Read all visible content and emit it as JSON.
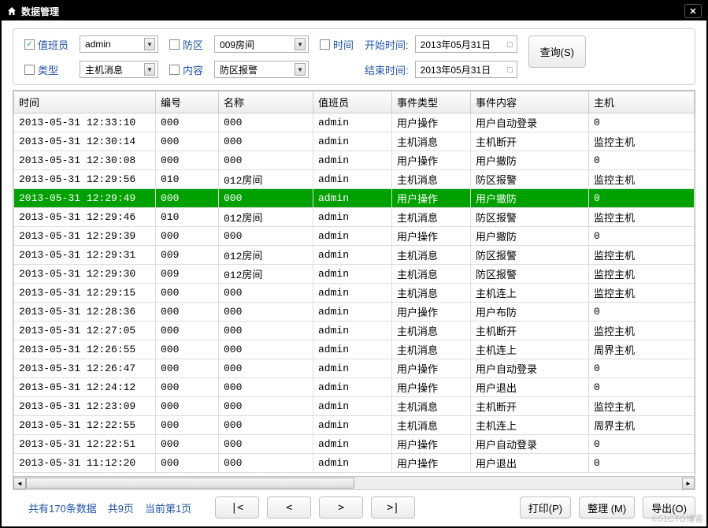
{
  "window": {
    "title": "数据管理"
  },
  "filters": {
    "operator": {
      "label": "值班员",
      "value": "admin",
      "checked": true
    },
    "type": {
      "label": "类型",
      "value": "主机消息",
      "checked": false
    },
    "zone": {
      "label": "防区",
      "value": "009房间",
      "checked": false
    },
    "content": {
      "label": "内容",
      "value": "防区报警",
      "checked": false
    },
    "time": {
      "label": "时间",
      "checked": false
    },
    "start": {
      "label": "开始时间:",
      "value": "2013年05月31日"
    },
    "end": {
      "label": "结束时间:",
      "value": "2013年05月31日"
    },
    "query_btn": "查询(S)"
  },
  "columns": [
    "时间",
    "编号",
    "名称",
    "值班员",
    "事件类型",
    "事件内容",
    "主机"
  ],
  "col_widths": [
    "180px",
    "80px",
    "120px",
    "100px",
    "100px",
    "150px",
    "auto"
  ],
  "rows": [
    {
      "sel": false,
      "c": [
        "2013-05-31 12:33:10",
        "000",
        "000",
        "admin",
        "用户操作",
        "用户自动登录",
        "0"
      ]
    },
    {
      "sel": false,
      "c": [
        "2013-05-31 12:30:14",
        "000",
        "000",
        "admin",
        "主机消息",
        "主机断开",
        "监控主机"
      ]
    },
    {
      "sel": false,
      "c": [
        "2013-05-31 12:30:08",
        "000",
        "000",
        "admin",
        "用户操作",
        "用户撤防",
        "0"
      ]
    },
    {
      "sel": false,
      "c": [
        "2013-05-31 12:29:56",
        "010",
        "012房间",
        "admin",
        "主机消息",
        "防区报警",
        "监控主机"
      ]
    },
    {
      "sel": true,
      "c": [
        "2013-05-31 12:29:49",
        "000",
        "000",
        "admin",
        "用户操作",
        "用户撤防",
        "0"
      ]
    },
    {
      "sel": false,
      "c": [
        "2013-05-31 12:29:46",
        "010",
        "012房间",
        "admin",
        "主机消息",
        "防区报警",
        "监控主机"
      ]
    },
    {
      "sel": false,
      "c": [
        "2013-05-31 12:29:39",
        "000",
        "000",
        "admin",
        "用户操作",
        "用户撤防",
        "0"
      ]
    },
    {
      "sel": false,
      "c": [
        "2013-05-31 12:29:31",
        "009",
        "012房间",
        "admin",
        "主机消息",
        "防区报警",
        "监控主机"
      ]
    },
    {
      "sel": false,
      "c": [
        "2013-05-31 12:29:30",
        "009",
        "012房间",
        "admin",
        "主机消息",
        "防区报警",
        "监控主机"
      ]
    },
    {
      "sel": false,
      "c": [
        "2013-05-31 12:29:15",
        "000",
        "000",
        "admin",
        "主机消息",
        "主机连上",
        "监控主机"
      ]
    },
    {
      "sel": false,
      "c": [
        "2013-05-31 12:28:36",
        "000",
        "000",
        "admin",
        "用户操作",
        "用户布防",
        "0"
      ]
    },
    {
      "sel": false,
      "c": [
        "2013-05-31 12:27:05",
        "000",
        "000",
        "admin",
        "主机消息",
        "主机断开",
        "监控主机"
      ]
    },
    {
      "sel": false,
      "c": [
        "2013-05-31 12:26:55",
        "000",
        "000",
        "admin",
        "主机消息",
        "主机连上",
        "周界主机"
      ]
    },
    {
      "sel": false,
      "c": [
        "2013-05-31 12:26:47",
        "000",
        "000",
        "admin",
        "用户操作",
        "用户自动登录",
        "0"
      ]
    },
    {
      "sel": false,
      "c": [
        "2013-05-31 12:24:12",
        "000",
        "000",
        "admin",
        "用户操作",
        "用户退出",
        "0"
      ]
    },
    {
      "sel": false,
      "c": [
        "2013-05-31 12:23:09",
        "000",
        "000",
        "admin",
        "主机消息",
        "主机断开",
        "监控主机"
      ]
    },
    {
      "sel": false,
      "c": [
        "2013-05-31 12:22:55",
        "000",
        "000",
        "admin",
        "主机消息",
        "主机连上",
        "周界主机"
      ]
    },
    {
      "sel": false,
      "c": [
        "2013-05-31 12:22:51",
        "000",
        "000",
        "admin",
        "用户操作",
        "用户自动登录",
        "0"
      ]
    },
    {
      "sel": false,
      "c": [
        "2013-05-31 11:12:20",
        "000",
        "000",
        "admin",
        "用户操作",
        "用户退出",
        "0"
      ]
    }
  ],
  "pagination": {
    "total_text": "共有170条数据",
    "pages_text": "共9页",
    "current_text": "当前第1页"
  },
  "buttons": {
    "first": "|<",
    "prev": "<",
    "next": ">",
    "last": ">|",
    "print": "打印(P)",
    "arrange": "整理 (M)",
    "export": "导出(O)"
  },
  "watermark": "©51CTO博客"
}
